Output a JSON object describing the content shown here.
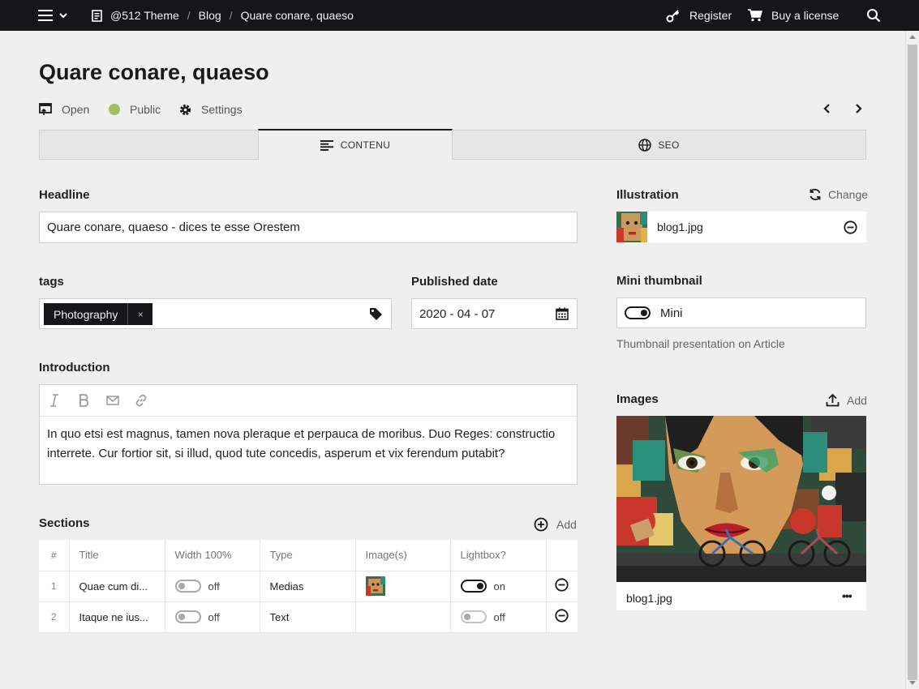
{
  "topbar": {
    "breadcrumb": [
      "@512 Theme",
      "Blog",
      "Quare conare, quaeso"
    ],
    "register": "Register",
    "buy": "Buy a license"
  },
  "page": {
    "title": "Quare conare, quaeso",
    "open": "Open",
    "visibility": "Public",
    "settings": "Settings",
    "visibility_color": "#a3bf5f"
  },
  "tabs": {
    "content": "CONTENU",
    "seo": "SEO"
  },
  "headline": {
    "label": "Headline",
    "value": "Quare conare, quaeso - dices te esse Orestem"
  },
  "tags": {
    "label": "tags",
    "items": [
      "Photography"
    ],
    "remove": "×"
  },
  "published": {
    "label": "Published date",
    "value": "2020 - 04 - 07"
  },
  "introduction": {
    "label": "Introduction",
    "text": "In quo etsi est magnus, tamen nova pleraque et perpauca de moribus. Duo Reges: constructio interrete. Cur fortior sit, si illud, quod tute concedis, asperum et vix ferendum putabit?"
  },
  "sections": {
    "label": "Sections",
    "add": "Add",
    "columns": [
      "#",
      "Title",
      "Width 100%",
      "Type",
      "Image(s)",
      "Lightbox?"
    ],
    "rows": [
      {
        "num": "1",
        "title": "Quae cum di...",
        "width": "off",
        "type": "Medias",
        "lightbox": "on"
      },
      {
        "num": "2",
        "title": "Itaque ne ius...",
        "width": "off",
        "type": "Text",
        "lightbox": "off"
      }
    ]
  },
  "illustration": {
    "label": "Illustration",
    "change": "Change",
    "file": "blog1.jpg"
  },
  "mini": {
    "label": "Mini thumbnail",
    "value": "Mini",
    "help": "Thumbnail presentation on Article"
  },
  "images": {
    "label": "Images",
    "add": "Add",
    "file": "blog1.jpg",
    "menu": "•••"
  }
}
